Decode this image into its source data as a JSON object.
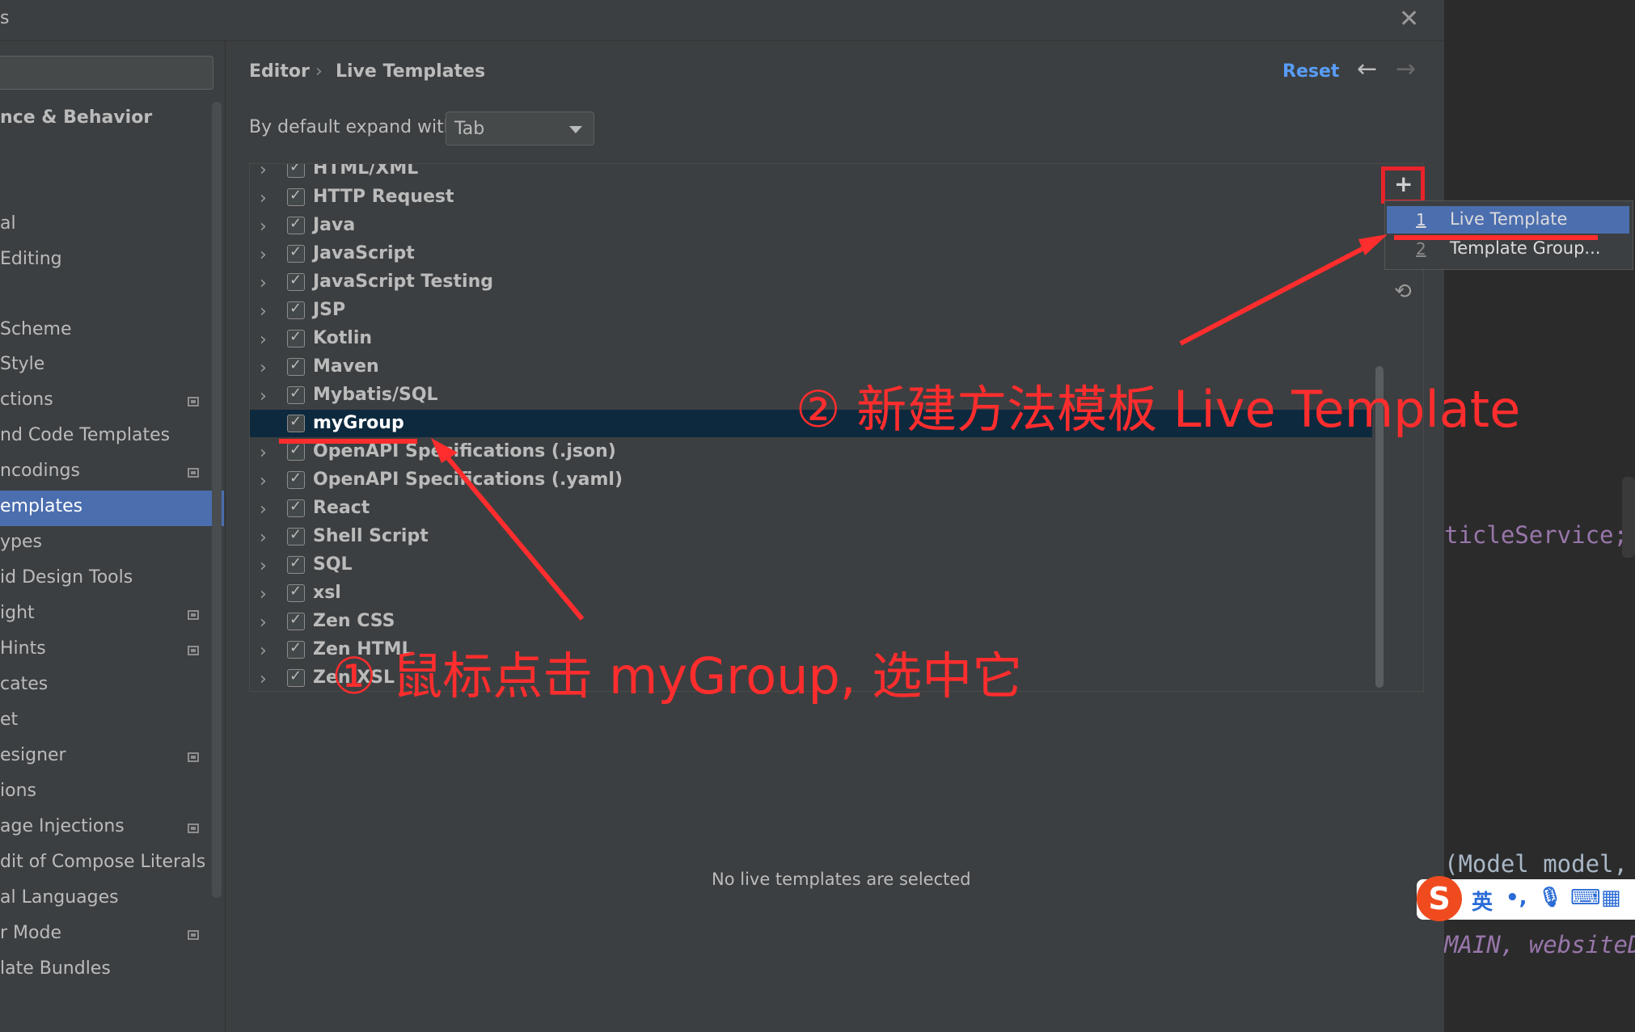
{
  "window": {
    "title": "s",
    "close_icon": "close-icon"
  },
  "sidebar": {
    "items": [
      {
        "label": "nce & Behavior",
        "top": 0,
        "bold": true
      },
      {
        "label": "al"
      },
      {
        "label": "Editing"
      },
      {
        "label": "Scheme"
      },
      {
        "label": "Style"
      },
      {
        "label": "ctions"
      },
      {
        "label": "nd Code Templates"
      },
      {
        "label": "ncodings"
      },
      {
        "label": "emplates"
      },
      {
        "label": "ypes"
      },
      {
        "label": "id Design Tools"
      },
      {
        "label": "ight"
      },
      {
        "label": "Hints"
      },
      {
        "label": "cates"
      },
      {
        "label": "et"
      },
      {
        "label": "esigner"
      },
      {
        "label": "ions"
      },
      {
        "label": "age Injections"
      },
      {
        "label": "dit of Compose Literals"
      },
      {
        "label": "al Languages"
      },
      {
        "label": "r Mode"
      },
      {
        "label": "late Bundles"
      }
    ]
  },
  "header": {
    "breadcrumb_1": "Editor",
    "breadcrumb_sep": "›",
    "breadcrumb_2": "Live Templates",
    "reset": "Reset",
    "back_icon": "←",
    "forward_icon": "→"
  },
  "expand": {
    "label": "By default expand with",
    "value": "Tab"
  },
  "tree": {
    "rows": [
      {
        "label": "HTML/XML",
        "expandable": true
      },
      {
        "label": "HTTP Request",
        "expandable": true
      },
      {
        "label": "Java",
        "expandable": true
      },
      {
        "label": "JavaScript",
        "expandable": true
      },
      {
        "label": "JavaScript Testing",
        "expandable": true
      },
      {
        "label": "JSP",
        "expandable": true
      },
      {
        "label": "Kotlin",
        "expandable": true
      },
      {
        "label": "Maven",
        "expandable": true
      },
      {
        "label": "Mybatis/SQL",
        "expandable": true
      },
      {
        "label": "myGroup",
        "expandable": false,
        "selected": true
      },
      {
        "label": "OpenAPI Specifications (.json)",
        "expandable": true
      },
      {
        "label": "OpenAPI Specifications (.yaml)",
        "expandable": true
      },
      {
        "label": "React",
        "expandable": true
      },
      {
        "label": "Shell Script",
        "expandable": true
      },
      {
        "label": "SQL",
        "expandable": true
      },
      {
        "label": "xsl",
        "expandable": true
      },
      {
        "label": "Zen CSS",
        "expandable": true
      },
      {
        "label": "Zen HTML",
        "expandable": true
      },
      {
        "label": "Zen XSL",
        "expandable": true
      }
    ]
  },
  "popup": {
    "items": [
      {
        "num": "1",
        "label": "Live Template",
        "selected": true
      },
      {
        "num": "2",
        "label": "Template Group...",
        "selected": false
      }
    ]
  },
  "empty_message": "No live templates are selected",
  "editor_code": {
    "line1": "ticleService;",
    "line2": "(Model model,",
    "line3": "MAIN, websiteD"
  },
  "ime": {
    "lang": "英",
    "punct": "•,",
    "mic": "🎤",
    "keyboard": "⌨",
    "grid": "▦"
  },
  "annotations": {
    "step1": "① 鼠标点击 myGroup, 选中它",
    "step2": "② 新建方法模板 Live Template"
  },
  "colors": {
    "accent": "#4b6eaf",
    "link": "#589df6",
    "annotation_red": "#ff2d2d",
    "selection_dark": "#0d293e"
  }
}
